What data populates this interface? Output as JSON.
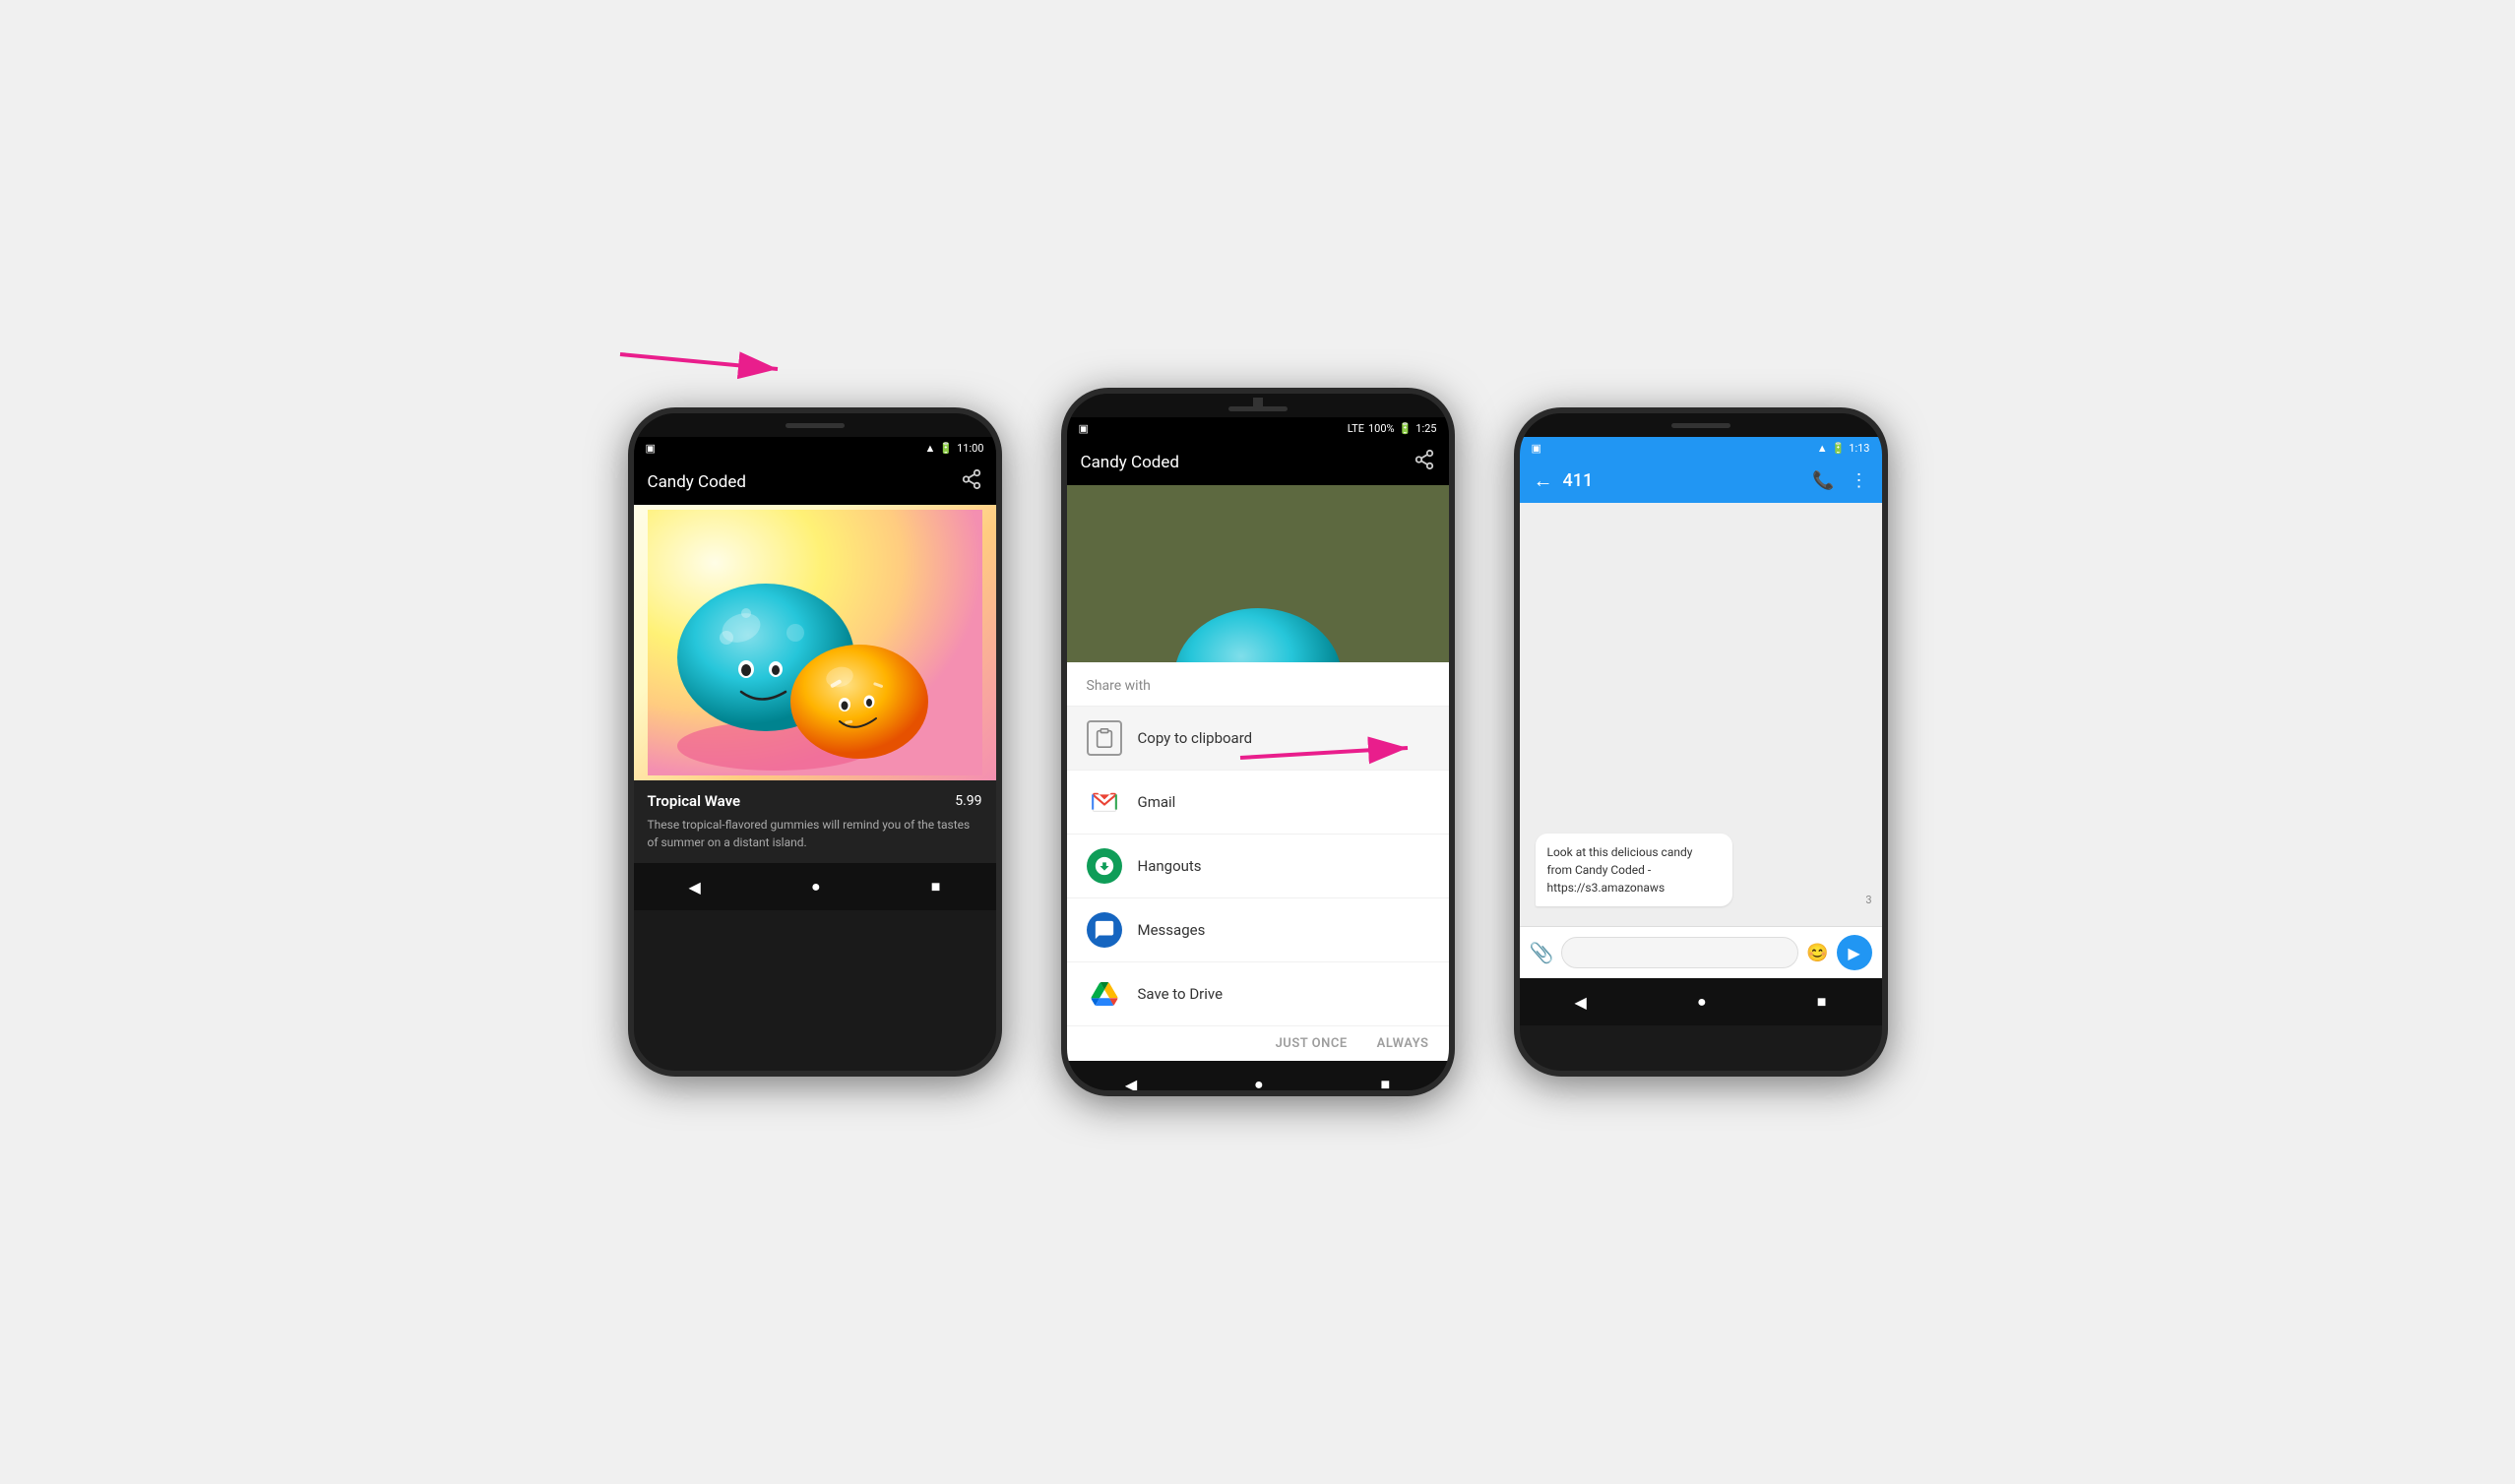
{
  "scene": {
    "background": "#f0f0f0"
  },
  "phone1": {
    "statusBar": {
      "time": "11:00",
      "battery": "🔋",
      "signal": "▲"
    },
    "appBar": {
      "title": "Candy Coded",
      "shareIcon": "share"
    },
    "candy": {
      "name": "Tropical Wave",
      "price": "5.99",
      "description": "These tropical-flavored gummies will remind you of the tastes of summer on a distant island."
    },
    "nav": {
      "back": "◀",
      "home": "●",
      "recent": "■"
    }
  },
  "phone2": {
    "statusBar": {
      "lte": "LTE",
      "battery": "100%",
      "time": "1:25"
    },
    "appBar": {
      "title": "Candy Coded",
      "shareIcon": "share"
    },
    "shareSheet": {
      "header": "Share with",
      "items": [
        {
          "id": "clipboard",
          "label": "Copy to clipboard",
          "icon": "clipboard"
        },
        {
          "id": "gmail",
          "label": "Gmail",
          "icon": "gmail"
        },
        {
          "id": "hangouts",
          "label": "Hangouts",
          "icon": "hangouts"
        },
        {
          "id": "messages",
          "label": "Messages",
          "icon": "messages"
        },
        {
          "id": "drive",
          "label": "Save to Drive",
          "icon": "drive"
        }
      ],
      "footer": {
        "justOnce": "JUST ONCE",
        "always": "ALWAYS"
      }
    },
    "nav": {
      "back": "◀",
      "home": "●",
      "recent": "■"
    }
  },
  "phone3": {
    "statusBar": {
      "time": "1:13",
      "battery": "🔋"
    },
    "appBar": {
      "backArrow": "←",
      "title": "411",
      "phoneIcon": "📞",
      "menuIcon": "⋮"
    },
    "message": {
      "text": "Look at this delicious candy from Candy Coded - https://s3.amazonaws",
      "count": "3"
    },
    "input": {
      "placeholder": "",
      "attachIcon": "📎",
      "emojiIcon": "😊",
      "sendIcon": "▶"
    },
    "nav": {
      "back": "◀",
      "home": "●",
      "recent": "■"
    }
  },
  "arrows": {
    "arrow1": {
      "label": "Share button to Phone 2",
      "color": "#E91E8C"
    },
    "arrow2": {
      "label": "Messages item to Phone 3",
      "color": "#E91E8C"
    }
  }
}
